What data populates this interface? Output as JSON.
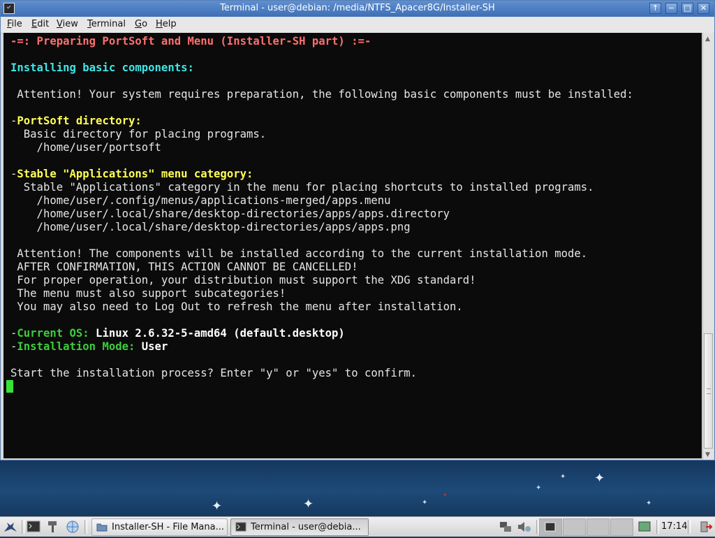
{
  "window": {
    "title": "Terminal - user@debian: /media/NTFS_Apacer8G/Installer-SH",
    "buttons": {
      "above": "↑",
      "minimize": "−",
      "maximize": "□",
      "close": "✕"
    }
  },
  "menubar": {
    "items": [
      {
        "key": "F",
        "rest": "ile"
      },
      {
        "key": "E",
        "rest": "dit"
      },
      {
        "key": "V",
        "rest": "iew"
      },
      {
        "key": "T",
        "rest": "erminal"
      },
      {
        "key": "G",
        "rest": "o"
      },
      {
        "key": "H",
        "rest": "elp"
      }
    ]
  },
  "terminal": {
    "header": "-=: Preparing PortSoft and Menu (Installer-SH part) :=-",
    "section": "Installing basic components:",
    "attention1": " Attention! Your system requires preparation, the following basic components must be installed:",
    "portsoft_dash": "-",
    "portsoft_title": "PortSoft directory:",
    "portsoft_desc": "  Basic directory for placing programs.",
    "portsoft_path": "    /home/user/portsoft",
    "menu_dash": "-",
    "menu_title": "Stable \"Applications\" menu category:",
    "menu_desc": "  Stable \"Applications\" category in the menu for placing shortcuts to installed programs.",
    "menu_path1": "    /home/user/.config/menus/applications-merged/apps.menu",
    "menu_path2": "    /home/user/.local/share/desktop-directories/apps/apps.directory",
    "menu_path3": "    /home/user/.local/share/desktop-directories/apps/apps.png",
    "note1": " Attention! The components will be installed according to the current installation mode.",
    "note2": " AFTER CONFIRMATION, THIS ACTION CANNOT BE CANCELLED!",
    "note3": " For proper operation, your distribution must support the XDG standard!",
    "note4": " The menu must also support subcategories!",
    "note5": " You may also need to Log Out to refresh the menu after installation.",
    "os_dash": "-",
    "os_label": "Current OS:",
    "os_value": " Linux 2.6.32-5-amd64 (default.desktop)",
    "mode_dash": "-",
    "mode_label": "Installation Mode:",
    "mode_value": " User",
    "prompt": "Start the installation process? Enter \"y\" or \"yes\" to confirm."
  },
  "taskbar": {
    "tasks": [
      {
        "label": "Installer-SH - File Mana...",
        "icon": "folder-icon"
      },
      {
        "label": "Terminal - user@debia...",
        "icon": "terminal-icon"
      }
    ],
    "clock": "17:14"
  },
  "colors": {
    "terminal_bg": "#0b0b0b",
    "header": "#ff6f6f",
    "section": "#3ee6e6",
    "highlight": "#ffff55",
    "label_green": "#3ccc3c",
    "cursor": "#35e535",
    "titlebar": "#4a7cc0"
  }
}
